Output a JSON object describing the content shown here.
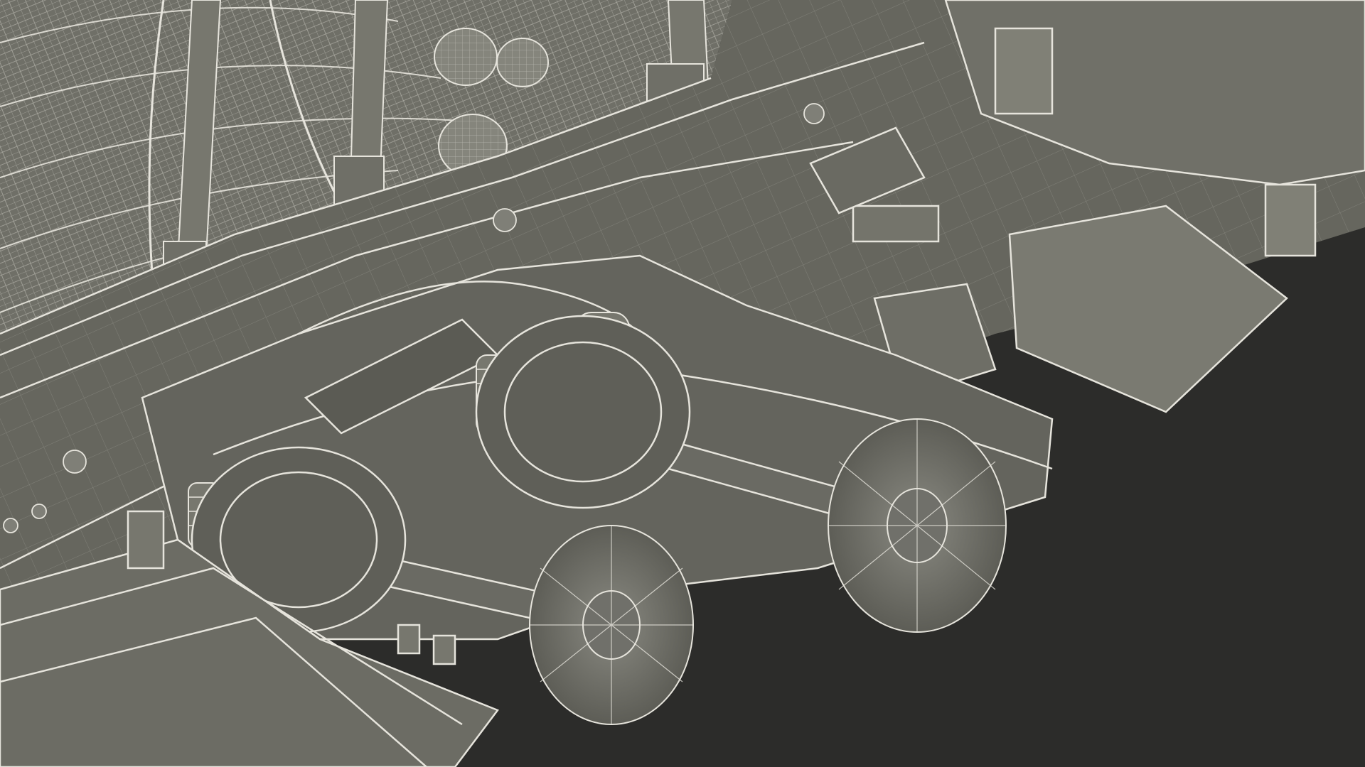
{
  "render": {
    "background_color": "#2c2c2a",
    "surface_color": "#6b6b63",
    "surface_dark": "#55554e",
    "surface_light": "#7d7d74",
    "wire_color": "#e6e4dc",
    "log_end_color": "#8a8a80"
  }
}
